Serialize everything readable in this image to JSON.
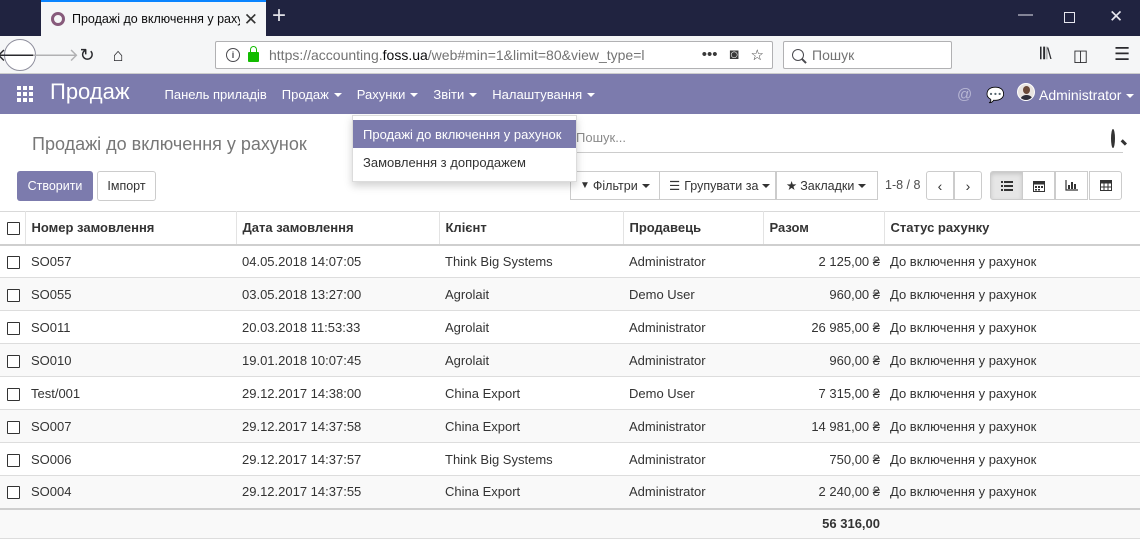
{
  "browser": {
    "tab_title": "Продажі до включення у рахунок",
    "url_prefix": "https://accounting.",
    "url_domain": "foss.ua",
    "url_suffix": "/web#min=1&limit=80&view_type=l",
    "search_placeholder": "Пошук",
    "icons": [
      "back-icon",
      "forward-icon",
      "reload-icon",
      "home-icon",
      "info-icon",
      "lock-icon",
      "more-icon",
      "pocket-icon",
      "star-icon",
      "library-icon",
      "sidebar-icon",
      "menu-icon"
    ]
  },
  "app": {
    "brand": "Продаж",
    "menu": [
      {
        "label": "Панель приладів",
        "dropdown": false
      },
      {
        "label": "Продаж",
        "dropdown": true
      },
      {
        "label": "Рахунки",
        "dropdown": true
      },
      {
        "label": "Звіти",
        "dropdown": true
      },
      {
        "label": "Налаштування",
        "dropdown": true
      }
    ],
    "user": "Administrator",
    "accent_color": "#7c7bad"
  },
  "dropdown": {
    "items": [
      {
        "label": "Продажі до включення у рахунок",
        "active": true
      },
      {
        "label": "Замовлення з допродажем",
        "active": false
      }
    ]
  },
  "control_panel": {
    "breadcrumb": "Продажі до включення у рахунок",
    "create_label": "Створити",
    "import_label": "Імпорт",
    "search_placeholder": "Пошук...",
    "filters_label": "Фільтри",
    "group_by_label": "Групувати за",
    "favorites_label": "Закладки",
    "pager": "1-8 / 8"
  },
  "table": {
    "columns": [
      "Номер замовлення",
      "Дата замовлення",
      "Клієнт",
      "Продавець",
      "Разом",
      "Статус рахунку"
    ],
    "rows": [
      [
        "SO057",
        "04.05.2018 14:07:05",
        "Think Big Systems",
        "Administrator",
        "2 125,00 ₴",
        "До включення у рахунок"
      ],
      [
        "SO055",
        "03.05.2018 13:27:00",
        "Agrolait",
        "Demo User",
        "960,00 ₴",
        "До включення у рахунок"
      ],
      [
        "SO011",
        "20.03.2018 11:53:33",
        "Agrolait",
        "Administrator",
        "26 985,00 ₴",
        "До включення у рахунок"
      ],
      [
        "SO010",
        "19.01.2018 10:07:45",
        "Agrolait",
        "Administrator",
        "960,00 ₴",
        "До включення у рахунок"
      ],
      [
        "Test/001",
        "29.12.2017 14:38:00",
        "China Export",
        "Demo User",
        "7 315,00 ₴",
        "До включення у рахунок"
      ],
      [
        "SO007",
        "29.12.2017 14:37:58",
        "China Export",
        "Administrator",
        "14 981,00 ₴",
        "До включення у рахунок"
      ],
      [
        "SO006",
        "29.12.2017 14:37:57",
        "Think Big Systems",
        "Administrator",
        "750,00 ₴",
        "До включення у рахунок"
      ],
      [
        "SO004",
        "29.12.2017 14:37:55",
        "China Export",
        "Administrator",
        "2 240,00 ₴",
        "До включення у рахунок"
      ]
    ],
    "total": "56 316,00"
  }
}
